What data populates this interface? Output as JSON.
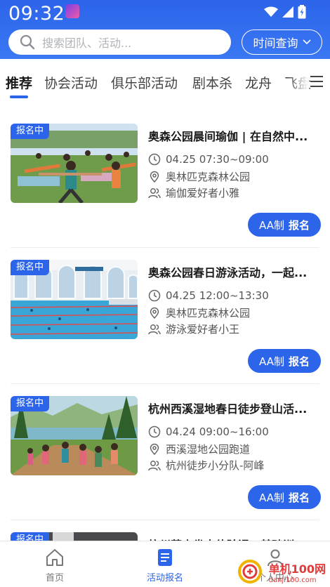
{
  "status_bar": {
    "time": "09:32"
  },
  "search": {
    "placeholder": "搜索团队、活动..."
  },
  "time_query": {
    "label": "时间查询"
  },
  "tabs": [
    {
      "label": "推荐",
      "active": true
    },
    {
      "label": "协会活动"
    },
    {
      "label": "俱乐部活动"
    },
    {
      "label": "剧本杀"
    },
    {
      "label": "龙舟"
    },
    {
      "label": "飞盘"
    }
  ],
  "colors": {
    "primary": "#2c64ea",
    "text": "#1a1a1a",
    "muted": "#555555"
  },
  "activities": [
    {
      "badge": "报名中",
      "title": "奥森公园晨间瑜伽 | 在自然中...",
      "time": "04.25 07:30~09:00",
      "location": "奥林匹克森林公园",
      "organizer": "瑜伽爱好者小雅",
      "fee_type": "AA制",
      "action": "报名",
      "image": "yoga-in-park"
    },
    {
      "badge": "报名中",
      "title": "奥森公园春日游泳活动，一起...",
      "time": "04.25 12:00~13:30",
      "location": "奥林匹克森林公园",
      "organizer": "游泳爱好者小王",
      "fee_type": "AA制",
      "action": "报名",
      "image": "indoor-swimming-pool"
    },
    {
      "badge": "报名中",
      "title": "杭州西溪湿地春日徒步登山活...",
      "time": "04.24 09:00~16:00",
      "location": "西溪湿地公园跑道",
      "organizer": "杭州徒步小分队-阿峰",
      "fee_type": "AA制",
      "action": "报名",
      "image": "wetland-hiking"
    },
    {
      "badge": "报名中",
      "title": "杭州萧山拳击体验课：基础训...",
      "image": "boxing-gym"
    }
  ],
  "bottom_nav": [
    {
      "label": "首页",
      "icon": "home-icon"
    },
    {
      "label": "活动报名",
      "icon": "signup-list-icon",
      "active": true
    },
    {
      "label": "个人中心",
      "icon": "user-icon"
    }
  ],
  "watermark": {
    "text": "单机100网",
    "url": "danji100.com"
  }
}
